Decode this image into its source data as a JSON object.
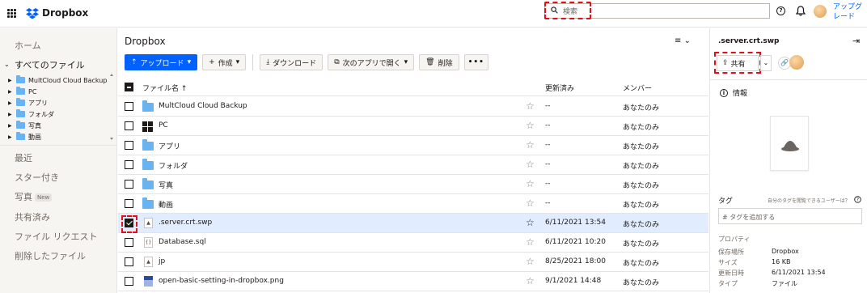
{
  "topbar": {
    "brand": "Dropbox",
    "search_placeholder": "検索",
    "help_glyph": "?",
    "upgrade_label": "アップグレード"
  },
  "sidebar": {
    "home": "ホーム",
    "all_files": "すべてのファイル",
    "tree": [
      "MultCloud Cloud Backup",
      "PC",
      "アプリ",
      "フォルダ",
      "写真",
      "動画"
    ],
    "recent": "最近",
    "starred": "スター付き",
    "photos": "写真",
    "photos_badge": "New",
    "shared": "共有済み",
    "file_requests": "ファイル リクエスト",
    "deleted": "削除したファイル"
  },
  "main": {
    "breadcrumb": "Dropbox",
    "toolbar": {
      "upload": "アップロード",
      "create": "作成",
      "download": "ダウンロード",
      "open_with": "次のアプリで開く",
      "delete": "削除",
      "more": "•••"
    },
    "columns": {
      "name": "ファイル名 ↑",
      "modified": "更新済み",
      "members": "メンバー"
    },
    "rows": [
      {
        "name": "MultCloud Cloud Backup",
        "modified": "--",
        "members": "あなたのみ",
        "icon": "folder-icon"
      },
      {
        "name": "PC",
        "modified": "--",
        "members": "あなたのみ",
        "icon": "windows-icon"
      },
      {
        "name": "アプリ",
        "modified": "--",
        "members": "あなたのみ",
        "icon": "folder-icon"
      },
      {
        "name": "フォルダ",
        "modified": "--",
        "members": "あなたのみ",
        "icon": "folder-icon"
      },
      {
        "name": "写真",
        "modified": "--",
        "members": "あなたのみ",
        "icon": "folder-icon"
      },
      {
        "name": "動画",
        "modified": "--",
        "members": "あなたのみ",
        "icon": "folder-icon"
      },
      {
        "name": ".server.crt.swp",
        "modified": "6/11/2021 13:54",
        "members": "あなたのみ",
        "icon": "file-icon",
        "selected": true
      },
      {
        "name": "Database.sql",
        "modified": "6/11/2021 10:20",
        "members": "あなたのみ",
        "icon": "code-file-icon"
      },
      {
        "name": "jp",
        "modified": "8/25/2021 18:00",
        "members": "あなたのみ",
        "icon": "file-icon"
      },
      {
        "name": "open-basic-setting-in-dropbox.png",
        "modified": "9/1/2021 14:48",
        "members": "あなたのみ",
        "icon": "image-file-icon"
      }
    ]
  },
  "panel": {
    "title": ".server.crt.swp",
    "share": "共有",
    "info": "情報",
    "tags_label": "タグ",
    "tags_hint": "自分のタグを閲覧できるユーザーは？",
    "tags_placeholder": "# タグを追加する",
    "properties_label": "プロパティ",
    "props": [
      {
        "key": "保存場所",
        "value": "Dropbox"
      },
      {
        "key": "サイズ",
        "value": "16 KB"
      },
      {
        "key": "更新日時",
        "value": "6/11/2021 13:54"
      },
      {
        "key": "タイプ",
        "value": "ファイル"
      }
    ]
  },
  "colors": {
    "accent": "#0061fe",
    "highlight": "#e0101a",
    "selected_row": "#e2ecff"
  }
}
